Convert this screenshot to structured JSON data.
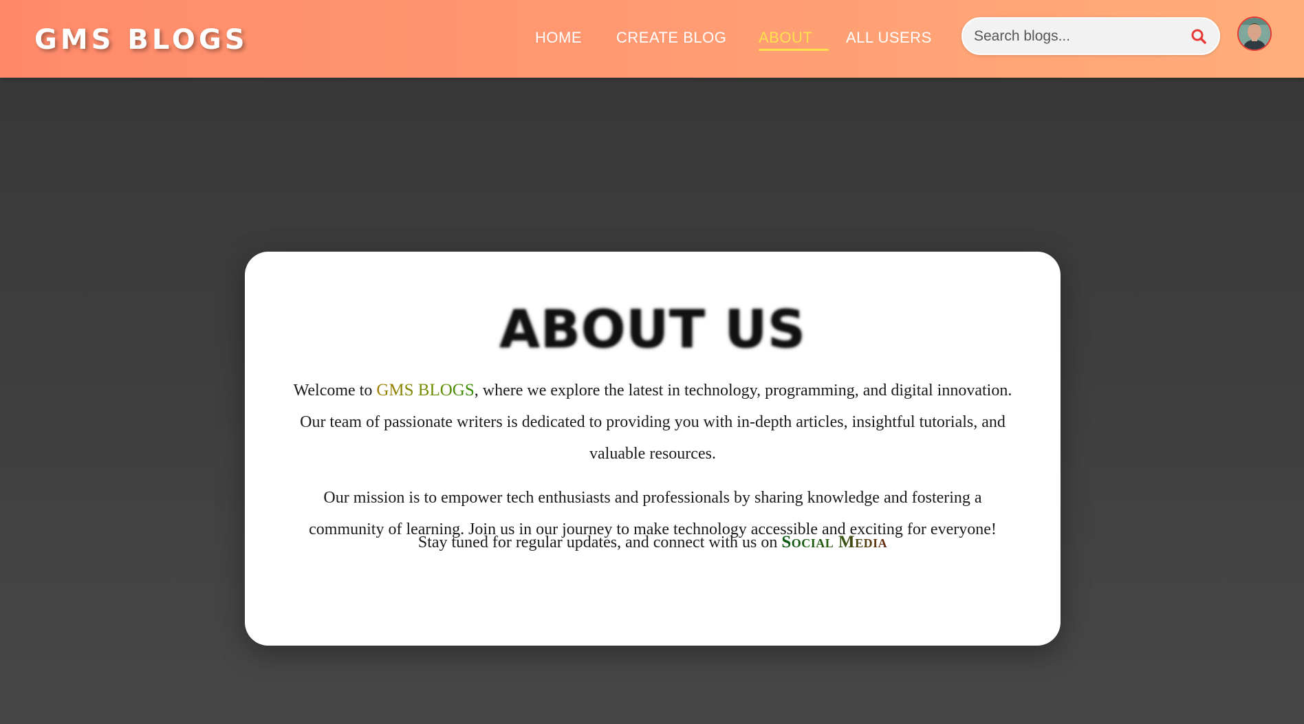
{
  "header": {
    "brand": "GMS BLOGS",
    "nav": [
      {
        "label": "HOME"
      },
      {
        "label": "CREATE BLOG"
      },
      {
        "label": "ABOUT"
      },
      {
        "label": "ALL USERS"
      }
    ],
    "active_nav": "ABOUT",
    "search": {
      "placeholder": "Search blogs..."
    },
    "colors": {
      "active": "#ffe14d",
      "search_icon": "#e53935"
    }
  },
  "about": {
    "title": "ABOUT US",
    "p1_before": "Welcome to ",
    "p1_brand": "GMS BLOGS",
    "p1_after": ", where we explore the latest in technology, programming, and digital innovation. Our team of passionate writers is dedicated to providing you with in-depth articles, insightful tutorials, and valuable resources.",
    "p2": "Our mission is to empower tech enthusiasts and professionals by sharing knowledge and fostering a community of learning. Join us in our journey to make technology accessible and exciting for everyone!",
    "p3_before": "Stay tuned for regular updates, and connect with us on ",
    "p3_link": "Social Media"
  },
  "icons": {
    "search": "search-icon",
    "avatar": "avatar"
  }
}
